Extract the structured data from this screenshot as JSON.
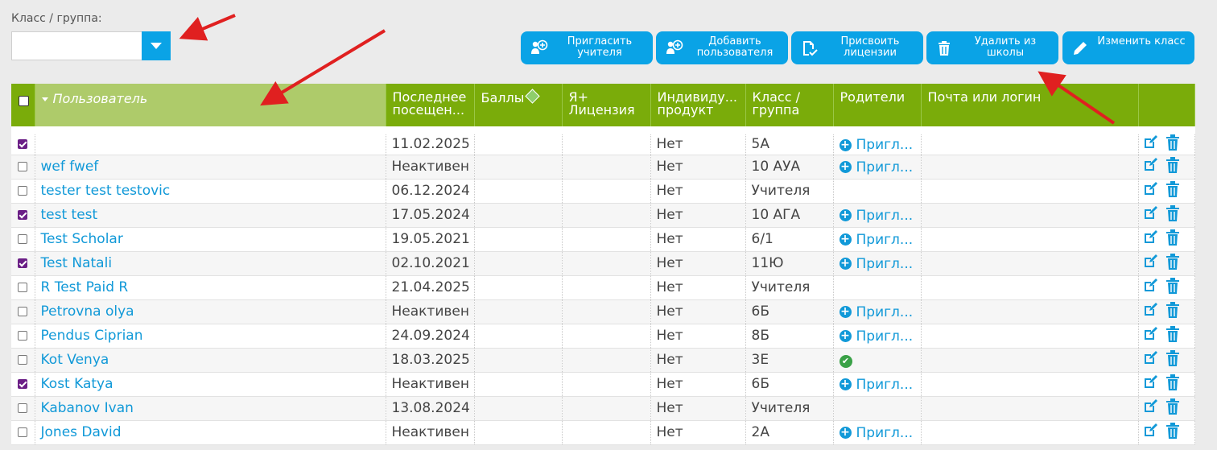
{
  "filter": {
    "label": "Класс / группа:",
    "value": ""
  },
  "toolbar": {
    "invite_teacher": "Пригласить учителя",
    "add_user": "Добавить пользователя",
    "assign_licenses": "Присвоить лицензии",
    "remove_from_school": "Удалить из школы",
    "edit_class": "Изменить класс"
  },
  "table": {
    "columns": {
      "user": "Пользователь",
      "last_visit": "Последнее посещен...",
      "points": "Баллы",
      "license": "Я+ Лицензия",
      "individual": "Индивиду... продукт",
      "class_group": "Класс / группа",
      "parents": "Родители",
      "email": "Почта или логин"
    },
    "rows": [
      {
        "name": "",
        "last": "11.02.2025",
        "ind": "Нет",
        "cls": "5А",
        "parent": "Пригл...",
        "checked": true,
        "parent_type": "invite"
      },
      {
        "name": "wef fwef",
        "last": "Неактивен",
        "ind": "Нет",
        "cls": "10 АУА",
        "parent": "Пригл...",
        "checked": false,
        "parent_type": "invite"
      },
      {
        "name": "tester test testovic",
        "last": "06.12.2024",
        "ind": "Нет",
        "cls": "Учителя",
        "parent": "",
        "checked": false,
        "parent_type": "none"
      },
      {
        "name": "test test",
        "last": "17.05.2024",
        "ind": "Нет",
        "cls": "10 АГА",
        "parent": "Пригл...",
        "checked": true,
        "parent_type": "invite"
      },
      {
        "name": "Test Scholar",
        "last": "19.05.2021",
        "ind": "Нет",
        "cls": "6/1",
        "parent": "Пригл...",
        "checked": false,
        "parent_type": "invite"
      },
      {
        "name": "Test Natali",
        "last": "02.10.2021",
        "ind": "Нет",
        "cls": "11Ю",
        "parent": "Пригл...",
        "checked": true,
        "parent_type": "invite"
      },
      {
        "name": "R Test Paid R",
        "last": "21.04.2025",
        "ind": "Нет",
        "cls": "Учителя",
        "parent": "",
        "checked": false,
        "parent_type": "none"
      },
      {
        "name": "Petrovna olya",
        "last": "Неактивен",
        "ind": "Нет",
        "cls": "6Б",
        "parent": "Пригл...",
        "checked": false,
        "parent_type": "invite"
      },
      {
        "name": "Pendus Ciprian",
        "last": "24.09.2024",
        "ind": "Нет",
        "cls": "8Б",
        "parent": "Пригл...",
        "checked": false,
        "parent_type": "invite"
      },
      {
        "name": "Kot Venya",
        "last": "18.03.2025",
        "ind": "Нет",
        "cls": "3Е",
        "parent": "",
        "checked": false,
        "parent_type": "linked"
      },
      {
        "name": "Kost Katya",
        "last": "Неактивен",
        "ind": "Нет",
        "cls": "6Б",
        "parent": "Пригл...",
        "checked": true,
        "parent_type": "invite"
      },
      {
        "name": "Kabanov Ivan",
        "last": "13.08.2024",
        "ind": "Нет",
        "cls": "Учителя",
        "parent": "",
        "checked": false,
        "parent_type": "none"
      },
      {
        "name": "Jones David",
        "last": "Неактивен",
        "ind": "Нет",
        "cls": "2А",
        "parent": "Пригл...",
        "checked": false,
        "parent_type": "invite"
      }
    ]
  },
  "colors": {
    "accent": "#0aa3e6",
    "header": "#7aac0a",
    "header_sorted": "#aecb6a",
    "link": "#1199d8",
    "checked": "#6b1f86",
    "annotation": "#e02020"
  }
}
